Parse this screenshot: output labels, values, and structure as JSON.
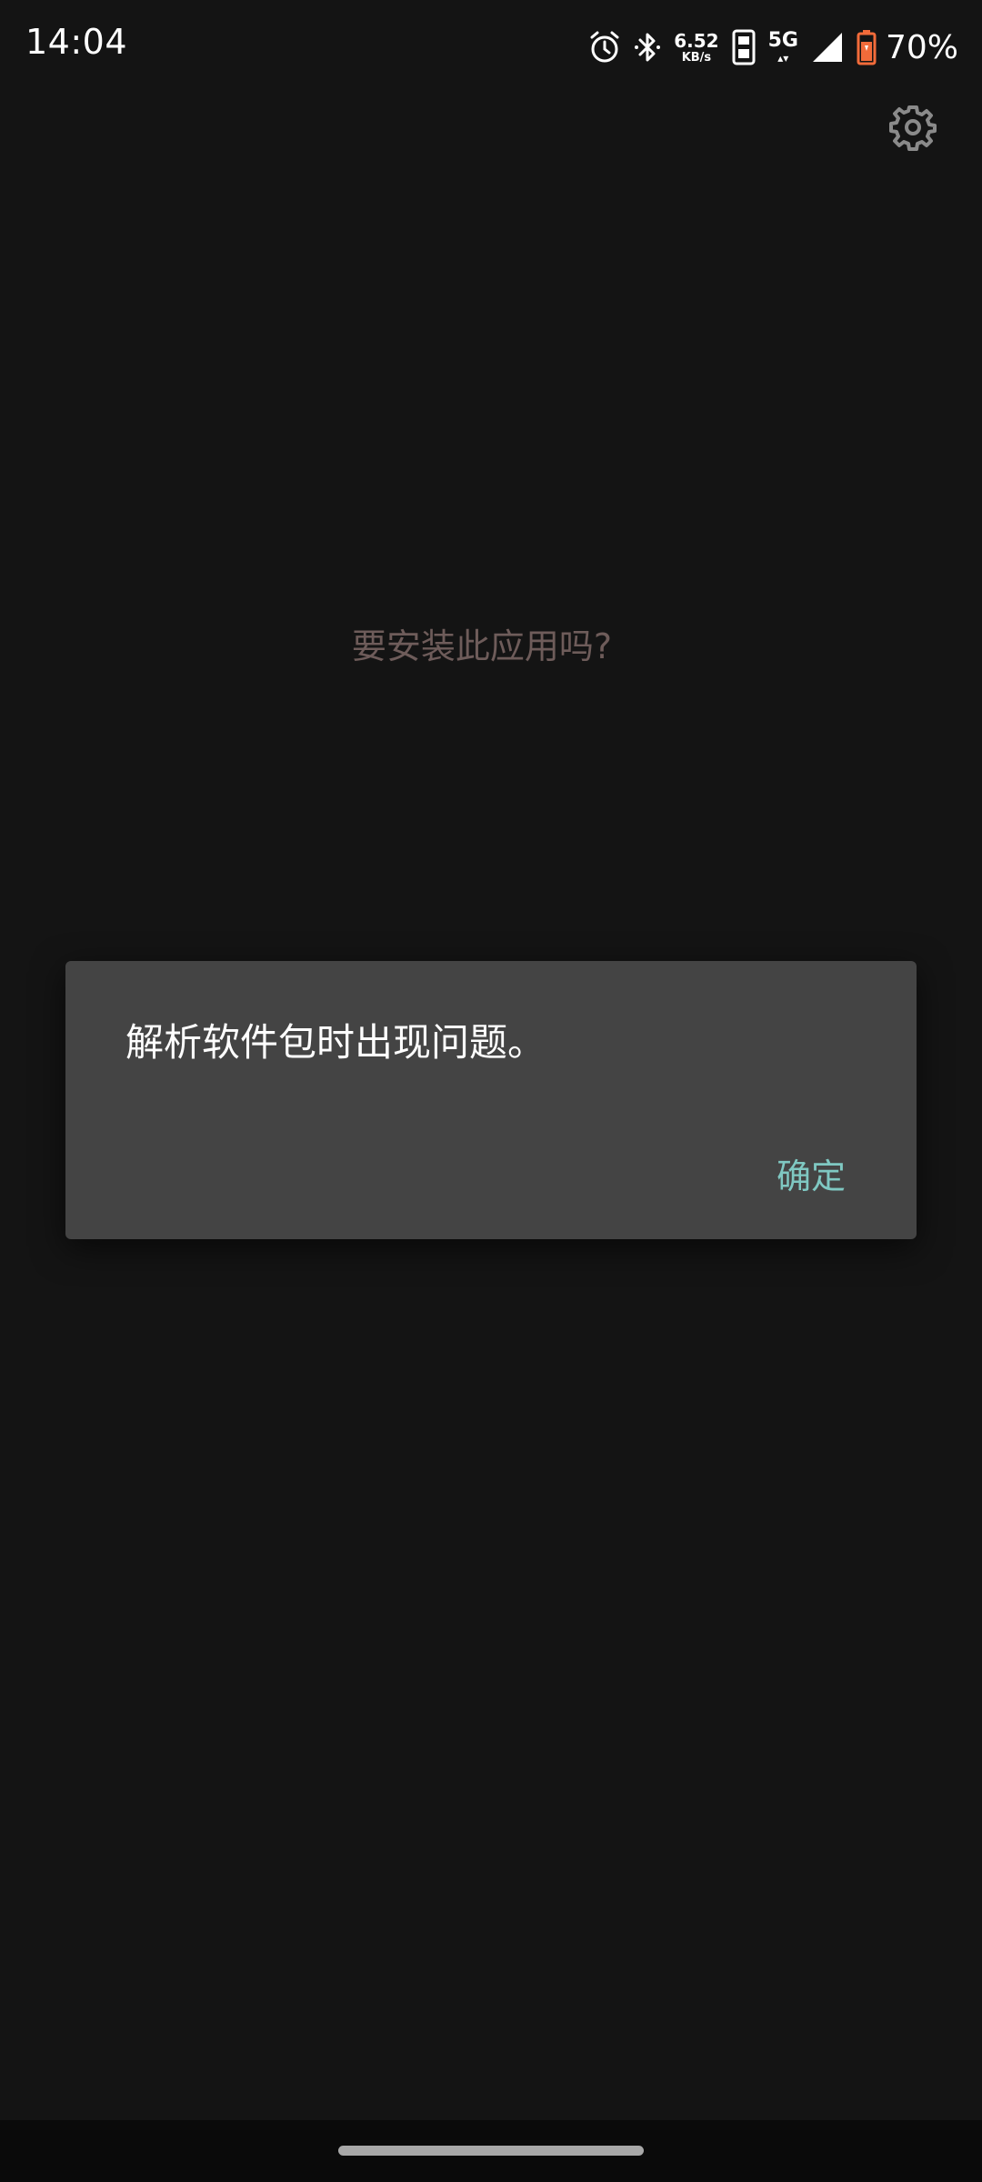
{
  "status_bar": {
    "time": "14:04",
    "net_speed_value": "6.52",
    "net_speed_unit": "KB/s",
    "network_type": "5G",
    "battery_percent": "70%",
    "icons": [
      "alarm-icon",
      "bluetooth-icon",
      "sim-icon",
      "signal-icon",
      "battery-icon"
    ]
  },
  "header": {
    "settings_icon": "gear-icon"
  },
  "installer": {
    "prompt": "要安装此应用吗?"
  },
  "dialog": {
    "message": "解析软件包时出现问题。",
    "ok_label": "确定"
  },
  "colors": {
    "background": "#141414",
    "dialog_bg": "#444444",
    "accent": "#7fc8c2",
    "prompt_text": "#6e5c5a",
    "battery": "#f26b3a"
  }
}
